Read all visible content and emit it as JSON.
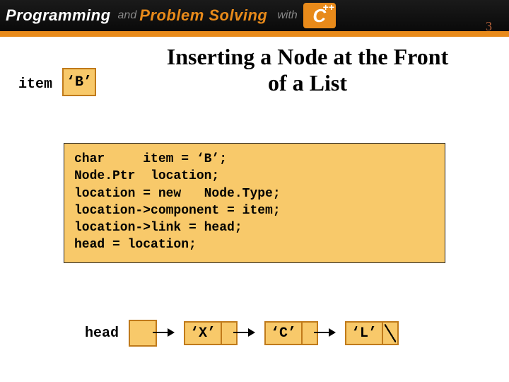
{
  "header": {
    "word1": "Programming",
    "and": "and",
    "word2": "Problem Solving",
    "with": "with",
    "lang_c": "C",
    "lang_pp": "++"
  },
  "title_line1": "Inserting a Node at the Front",
  "title_line2": "of a List",
  "item_label": "item",
  "item_value": "‘B’",
  "code_lines": [
    "char     item = ‘B’;",
    "Node.Ptr  location;",
    "location = new   Node.Type;",
    "location->component = item;",
    "location->link = head;",
    "head = location;"
  ],
  "head_label": "head",
  "nodes": [
    {
      "val": "‘X’",
      "terminal": false
    },
    {
      "val": "‘C’",
      "terminal": false
    },
    {
      "val": "‘L’",
      "terminal": true
    }
  ],
  "page_number": "3"
}
